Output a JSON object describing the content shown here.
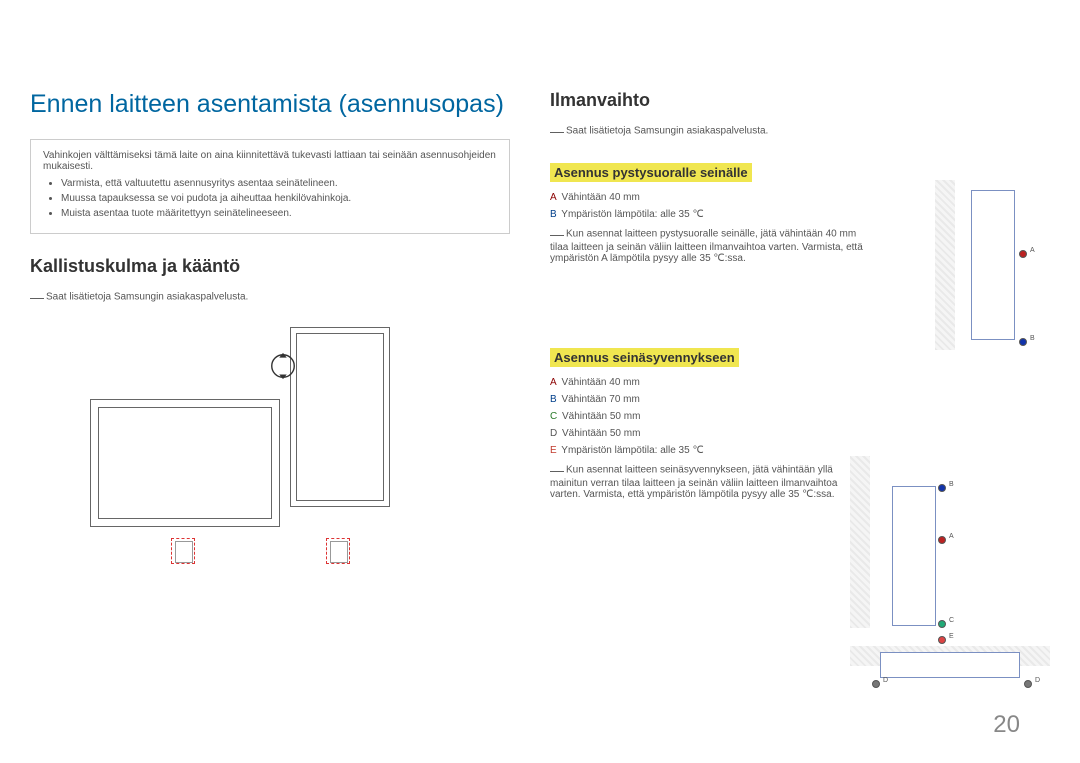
{
  "page_number": "20",
  "left": {
    "h1": "Ennen laitteen asentamista (asennusopas)",
    "warn_intro": "Vahinkojen välttämiseksi tämä laite on aina kiinnitettävä tukevasti lattiaan tai seinään asennusohjeiden mukaisesti.",
    "warn_items": [
      "Varmista, että valtuutettu asennusyritys asentaa seinätelineen.",
      "Muussa tapauksessa se voi pudota ja aiheuttaa henkilövahinkoja.",
      "Muista asentaa tuote määritettyyn seinätelineeseen."
    ],
    "h2": "Kallistuskulma ja kääntö",
    "note": "Saat lisätietoja Samsungin asiakaspalvelusta."
  },
  "right": {
    "h2": "Ilmanvaihto",
    "note": "Saat lisätietoja Samsungin asiakaspalvelusta.",
    "sec1_title": "Asennus pystysuoralle seinälle",
    "sec1_a": "Vähintään 40 mm",
    "sec1_b": "Ympäristön lämpötila: alle 35 ℃",
    "sec1_note": "Kun asennat laitteen pystysuoralle seinälle, jätä vähintään 40 mm tilaa laitteen ja seinän väliin laitteen ilmanvaihtoa varten. Varmista, että ympäristön A lämpötila pysyy alle 35 ℃:ssa.",
    "sec2_title": "Asennus seinäsyvennykseen",
    "sec2_a": "Vähintään 40 mm",
    "sec2_b": "Vähintään 70 mm",
    "sec2_c": "Vähintään 50 mm",
    "sec2_d": "Vähintään 50 mm",
    "sec2_e": "Ympäristön lämpötila: alle 35 ℃",
    "sec2_note": "Kun asennat laitteen seinäsyvennykseen, jätä vähintään yllä mainitun verran tilaa laitteen ja seinän väliin laitteen ilmanvaihtoa varten. Varmista, että ympäristön lämpötila pysyy alle 35 ℃:ssa."
  },
  "labels": {
    "A": "A",
    "B": "B",
    "C": "C",
    "D": "D",
    "E": "E"
  }
}
